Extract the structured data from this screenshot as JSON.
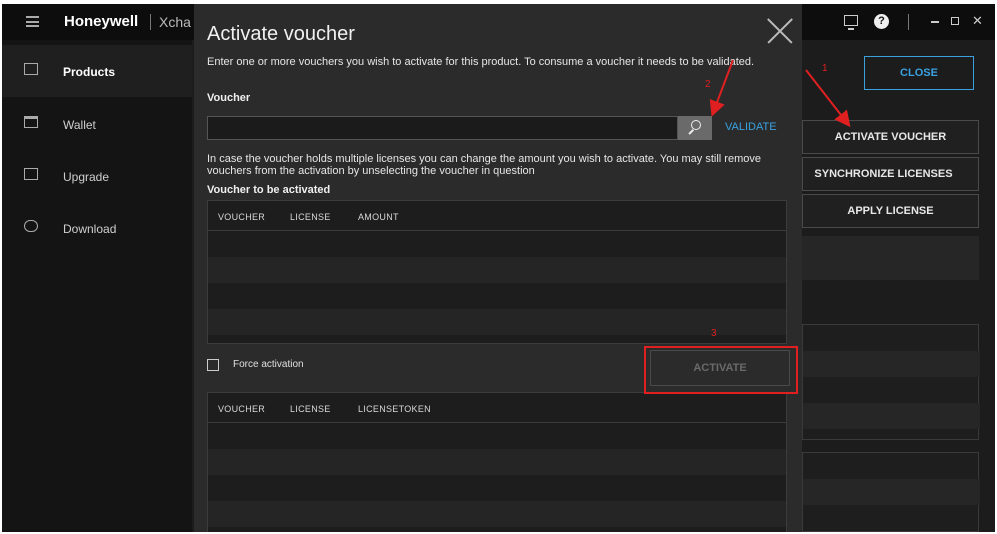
{
  "app": {
    "brand": "Honeywell",
    "subtitle": "Xcha"
  },
  "sidebar": {
    "items": [
      {
        "label": "Products",
        "icon": "products-icon",
        "active": true
      },
      {
        "label": "Wallet",
        "icon": "wallet-icon",
        "active": false
      },
      {
        "label": "Upgrade",
        "icon": "upgrade-icon",
        "active": false
      },
      {
        "label": "Download",
        "icon": "download-icon",
        "active": false
      }
    ]
  },
  "right_pane": {
    "close_label": "CLOSE",
    "activate_voucher_label": "ACTIVATE VOUCHER",
    "synchronize_label": "SYNCHRONIZE LICENSES",
    "apply_label": "APPLY LICENSE"
  },
  "modal": {
    "title": "Activate voucher",
    "intro": "Enter one or more vouchers you wish to activate for this product. To consume a voucher it needs to be validated.",
    "voucher_label": "Voucher",
    "voucher_value": "",
    "validate_label": "VALIDATE",
    "info": "In case the voucher holds multiple licenses you can change the amount you wish to activate. You may still remove vouchers from the activation by unselecting the voucher in question",
    "to_activate_label": "Voucher to be activated",
    "table1_headers": [
      "VOUCHER",
      "LICENSE",
      "AMOUNT"
    ],
    "force_label": "Force activation",
    "force_checked": false,
    "activate_label": "ACTIVATE",
    "table2_headers": [
      "VOUCHER",
      "LICENSE",
      "LICENSETOKEN"
    ]
  },
  "annotations": {
    "step1": "1",
    "step2": "2",
    "step3": "3",
    "color": "#e02020"
  },
  "colors": {
    "accent": "#3aa1e0",
    "background": "#1c1c1c",
    "modal": "#2b2b2b"
  }
}
